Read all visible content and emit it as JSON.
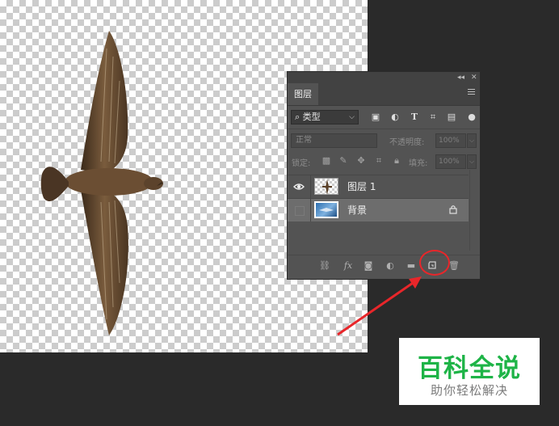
{
  "panel": {
    "collapse_glyph": "◂◂",
    "close_glyph": "✕",
    "tab_label": "图层",
    "filter": {
      "kind_label": "类型",
      "chevron": "⌵"
    },
    "blend_mode": "正常",
    "opacity_label": "不透明度:",
    "opacity_value": "100%",
    "lock_label": "锁定:",
    "fill_label": "填充:",
    "fill_value": "100%",
    "layers": [
      {
        "name": "图层 1",
        "visible": true,
        "selected": false
      },
      {
        "name": "背景",
        "visible": false,
        "selected": true,
        "locked": true
      }
    ],
    "bottom_icons": [
      "link-icon",
      "fx-icon",
      "mask-icon",
      "adjustment-icon",
      "folder-icon",
      "new-layer-icon",
      "trash-icon"
    ],
    "fx_label": "fx"
  },
  "annotation": {
    "highlight_color": "#e8262a"
  },
  "watermark": {
    "title": "百科全说",
    "subtitle": "助你轻松解决",
    "title_color": "#1eb447"
  }
}
